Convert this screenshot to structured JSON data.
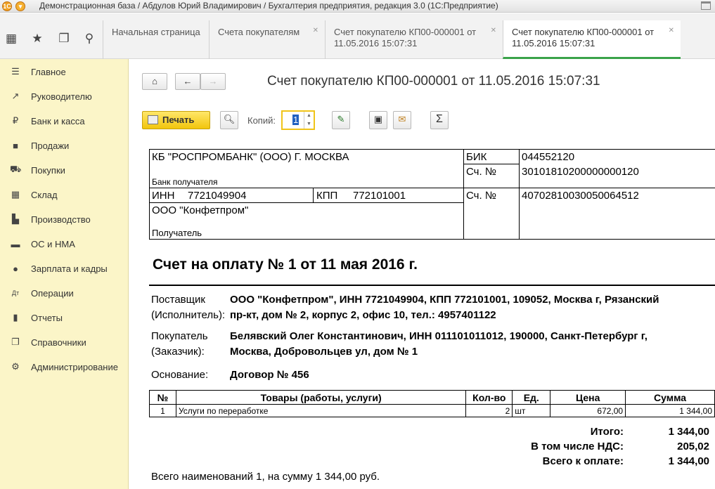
{
  "window": {
    "title": "Демонстрационная база / Абдулов Юрий Владимирович / Бухгалтерия предприятия, редакция 3.0 (1С:Предприятие)"
  },
  "tabs": [
    {
      "label": "Начальная страница"
    },
    {
      "label": "Счета покупателям"
    },
    {
      "label": "Счет покупателю КП00-000001 от 11.05.2016 15:07:31"
    },
    {
      "label": "Счет покупателю КП00-000001 от 11.05.2016 15:07:31"
    }
  ],
  "sidebar": {
    "items": [
      {
        "label": "Главное",
        "icon": "menu-icon"
      },
      {
        "label": "Руководителю",
        "icon": "trend-icon"
      },
      {
        "label": "Банк и касса",
        "icon": "ruble-icon"
      },
      {
        "label": "Продажи",
        "icon": "bag-icon"
      },
      {
        "label": "Покупки",
        "icon": "cart-icon"
      },
      {
        "label": "Склад",
        "icon": "warehouse-icon"
      },
      {
        "label": "Производство",
        "icon": "factory-icon"
      },
      {
        "label": "ОС и НМА",
        "icon": "truck-icon"
      },
      {
        "label": "Зарплата и кадры",
        "icon": "person-icon"
      },
      {
        "label": "Операции",
        "icon": "debit-credit-icon"
      },
      {
        "label": "Отчеты",
        "icon": "bar-chart-icon"
      },
      {
        "label": "Справочники",
        "icon": "books-icon"
      },
      {
        "label": "Администрирование",
        "icon": "gear-icon"
      }
    ]
  },
  "document": {
    "title": "Счет покупателю КП00-000001 от 11.05.2016 15:07:31",
    "print_label": "Печать",
    "copies_label": "Копий:",
    "copies_value": "1",
    "sum_symbol": "Σ"
  },
  "invoice": {
    "bank_name": "КБ \"РОСПРОМБАНК\" (ООО) Г. МОСКВА",
    "bank_recipient_label": "Банк получателя",
    "bik_label": "БИК",
    "bik_value": "044552120",
    "corr_label": "Сч. №",
    "corr_value": "30101810200000000120",
    "inn_label": "ИНН",
    "inn_value": "7721049904",
    "kpp_label": "КПП",
    "kpp_value": "772101001",
    "acc_label": "Сч. №",
    "acc_value": "40702810030050064512",
    "recipient_name": "ООО \"Конфетпром\"",
    "recipient_label": "Получатель",
    "heading": "Счет на оплату № 1 от 11 мая 2016 г.",
    "supplier_label1": "Поставщик",
    "supplier_label2": "(Исполнитель):",
    "supplier_line1": "ООО \"Конфетпром\", ИНН 7721049904, КПП 772101001, 109052, Москва г, Рязанский",
    "supplier_line2": "пр-кт, дом № 2, корпус 2, офис 10, тел.: 4957401122",
    "buyer_label1": "Покупатель",
    "buyer_label2": "(Заказчик):",
    "buyer_line1": "Белявский Олег Константинович, ИНН 011101011012, 190000, Санкт-Петербург г,",
    "buyer_line2": "Москва, Добровольцев ул, дом № 1",
    "basis_label": "Основание:",
    "basis_value": "Договор № 456",
    "columns": [
      "№",
      "Товары (работы, услуги)",
      "Кол-во",
      "Ед.",
      "Цена",
      "Сумма"
    ],
    "rows": [
      {
        "num": "1",
        "name": "Услуги по переработке",
        "qty": "2",
        "unit": "шт",
        "price": "672,00",
        "sum": "1 344,00"
      }
    ],
    "total_label": "Итого:",
    "total_value": "1 344,00",
    "vat_label": "В том числе НДС:",
    "vat_value": "205,02",
    "pay_label": "Всего к оплате:",
    "pay_value": "1 344,00",
    "summary": "Всего наименований 1, на сумму 1 344,00 руб."
  }
}
